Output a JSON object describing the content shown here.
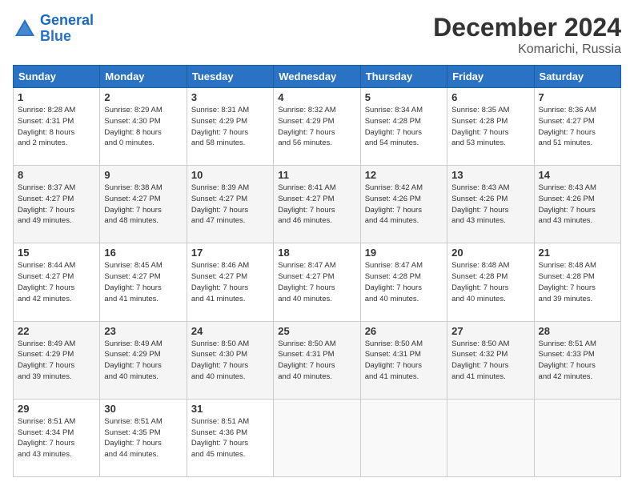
{
  "header": {
    "logo_general": "General",
    "logo_blue": "Blue",
    "title": "December 2024",
    "subtitle": "Komarichi, Russia"
  },
  "weekdays": [
    "Sunday",
    "Monday",
    "Tuesday",
    "Wednesday",
    "Thursday",
    "Friday",
    "Saturday"
  ],
  "weeks": [
    [
      {
        "day": "1",
        "detail": "Sunrise: 8:28 AM\nSunset: 4:31 PM\nDaylight: 8 hours\nand 2 minutes."
      },
      {
        "day": "2",
        "detail": "Sunrise: 8:29 AM\nSunset: 4:30 PM\nDaylight: 8 hours\nand 0 minutes."
      },
      {
        "day": "3",
        "detail": "Sunrise: 8:31 AM\nSunset: 4:29 PM\nDaylight: 7 hours\nand 58 minutes."
      },
      {
        "day": "4",
        "detail": "Sunrise: 8:32 AM\nSunset: 4:29 PM\nDaylight: 7 hours\nand 56 minutes."
      },
      {
        "day": "5",
        "detail": "Sunrise: 8:34 AM\nSunset: 4:28 PM\nDaylight: 7 hours\nand 54 minutes."
      },
      {
        "day": "6",
        "detail": "Sunrise: 8:35 AM\nSunset: 4:28 PM\nDaylight: 7 hours\nand 53 minutes."
      },
      {
        "day": "7",
        "detail": "Sunrise: 8:36 AM\nSunset: 4:27 PM\nDaylight: 7 hours\nand 51 minutes."
      }
    ],
    [
      {
        "day": "8",
        "detail": "Sunrise: 8:37 AM\nSunset: 4:27 PM\nDaylight: 7 hours\nand 49 minutes."
      },
      {
        "day": "9",
        "detail": "Sunrise: 8:38 AM\nSunset: 4:27 PM\nDaylight: 7 hours\nand 48 minutes."
      },
      {
        "day": "10",
        "detail": "Sunrise: 8:39 AM\nSunset: 4:27 PM\nDaylight: 7 hours\nand 47 minutes."
      },
      {
        "day": "11",
        "detail": "Sunrise: 8:41 AM\nSunset: 4:27 PM\nDaylight: 7 hours\nand 46 minutes."
      },
      {
        "day": "12",
        "detail": "Sunrise: 8:42 AM\nSunset: 4:26 PM\nDaylight: 7 hours\nand 44 minutes."
      },
      {
        "day": "13",
        "detail": "Sunrise: 8:43 AM\nSunset: 4:26 PM\nDaylight: 7 hours\nand 43 minutes."
      },
      {
        "day": "14",
        "detail": "Sunrise: 8:43 AM\nSunset: 4:26 PM\nDaylight: 7 hours\nand 43 minutes."
      }
    ],
    [
      {
        "day": "15",
        "detail": "Sunrise: 8:44 AM\nSunset: 4:27 PM\nDaylight: 7 hours\nand 42 minutes."
      },
      {
        "day": "16",
        "detail": "Sunrise: 8:45 AM\nSunset: 4:27 PM\nDaylight: 7 hours\nand 41 minutes."
      },
      {
        "day": "17",
        "detail": "Sunrise: 8:46 AM\nSunset: 4:27 PM\nDaylight: 7 hours\nand 41 minutes."
      },
      {
        "day": "18",
        "detail": "Sunrise: 8:47 AM\nSunset: 4:27 PM\nDaylight: 7 hours\nand 40 minutes."
      },
      {
        "day": "19",
        "detail": "Sunrise: 8:47 AM\nSunset: 4:28 PM\nDaylight: 7 hours\nand 40 minutes."
      },
      {
        "day": "20",
        "detail": "Sunrise: 8:48 AM\nSunset: 4:28 PM\nDaylight: 7 hours\nand 40 minutes."
      },
      {
        "day": "21",
        "detail": "Sunrise: 8:48 AM\nSunset: 4:28 PM\nDaylight: 7 hours\nand 39 minutes."
      }
    ],
    [
      {
        "day": "22",
        "detail": "Sunrise: 8:49 AM\nSunset: 4:29 PM\nDaylight: 7 hours\nand 39 minutes."
      },
      {
        "day": "23",
        "detail": "Sunrise: 8:49 AM\nSunset: 4:29 PM\nDaylight: 7 hours\nand 40 minutes."
      },
      {
        "day": "24",
        "detail": "Sunrise: 8:50 AM\nSunset: 4:30 PM\nDaylight: 7 hours\nand 40 minutes."
      },
      {
        "day": "25",
        "detail": "Sunrise: 8:50 AM\nSunset: 4:31 PM\nDaylight: 7 hours\nand 40 minutes."
      },
      {
        "day": "26",
        "detail": "Sunrise: 8:50 AM\nSunset: 4:31 PM\nDaylight: 7 hours\nand 41 minutes."
      },
      {
        "day": "27",
        "detail": "Sunrise: 8:50 AM\nSunset: 4:32 PM\nDaylight: 7 hours\nand 41 minutes."
      },
      {
        "day": "28",
        "detail": "Sunrise: 8:51 AM\nSunset: 4:33 PM\nDaylight: 7 hours\nand 42 minutes."
      }
    ],
    [
      {
        "day": "29",
        "detail": "Sunrise: 8:51 AM\nSunset: 4:34 PM\nDaylight: 7 hours\nand 43 minutes."
      },
      {
        "day": "30",
        "detail": "Sunrise: 8:51 AM\nSunset: 4:35 PM\nDaylight: 7 hours\nand 44 minutes."
      },
      {
        "day": "31",
        "detail": "Sunrise: 8:51 AM\nSunset: 4:36 PM\nDaylight: 7 hours\nand 45 minutes."
      },
      null,
      null,
      null,
      null
    ]
  ]
}
